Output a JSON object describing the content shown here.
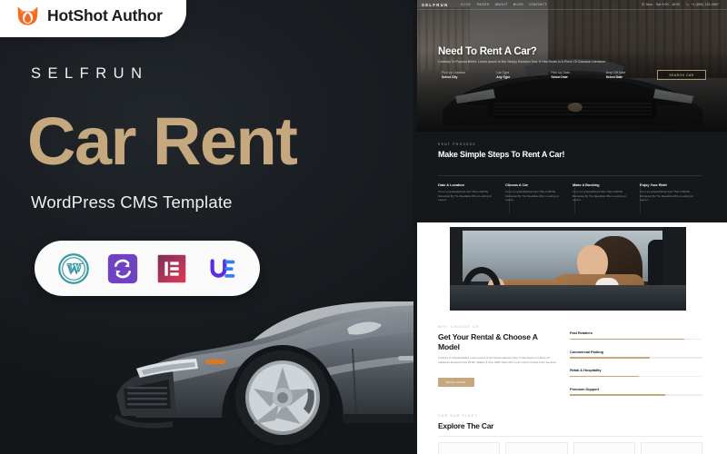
{
  "promo": {
    "author_badge": {
      "label": "HotShot Author",
      "icon": "fox-flame-icon"
    },
    "brand": "SELFRUN",
    "title": "Car Rent",
    "subtitle": "WordPress CMS Template",
    "tech_badges": [
      {
        "name": "wordpress-icon",
        "label": "WordPress",
        "color": "#21759b"
      },
      {
        "name": "revolution-slider-icon",
        "label": "Revolution Slider",
        "color": "#6f42c1"
      },
      {
        "name": "elementor-icon",
        "label": "Elementor",
        "color": "#d9346a"
      },
      {
        "name": "unlimited-elements-icon",
        "label": "Unlimited Elements",
        "color": "#5b2ee6"
      }
    ],
    "background": "#14171a",
    "accent": "#c6a87f"
  },
  "site": {
    "header": {
      "logo": "SELFRUN",
      "nav": [
        {
          "label": "Home",
          "active": true
        },
        {
          "label": "Pages",
          "active": false
        },
        {
          "label": "About",
          "active": false
        },
        {
          "label": "Blog",
          "active": false
        },
        {
          "label": "Contact",
          "active": false
        }
      ],
      "contact": [
        {
          "icon": "clock-icon",
          "text": "Mon - Sat 9:00 - 18:00"
        },
        {
          "icon": "phone-icon",
          "text": "+1 (800) 123-4567"
        }
      ]
    },
    "hero": {
      "title": "Need To Rent A Car?",
      "subtitle": "Contrary To Popular Belief, Lorem Ipsum Is Not Simply Random Text. It Has Roots In A Piece Of Classical Literature.",
      "fields": [
        {
          "label": "Pick Up Location",
          "value": "Select City"
        },
        {
          "label": "Car Type",
          "value": "Any Type"
        },
        {
          "label": "Pick Up Date",
          "value": "Select Date"
        },
        {
          "label": "Drop Off Date",
          "value": "Select Date"
        }
      ],
      "button": "Search Car"
    },
    "steps": {
      "eyebrow": "Rent Process",
      "title": "Make Simple Steps To Rent A Car!",
      "cards": [
        {
          "title": "Date & Location",
          "desc": "It Is A Long Established Fact That A Will Be Distracted By The Readable When Looking At Layout."
        },
        {
          "title": "Choose A Car",
          "desc": "It Is A Long Established Fact That A Will Be Distracted By The Readable When Looking At Layout."
        },
        {
          "title": "Make A Booking",
          "desc": "It Is A Long Established Fact That A Will Be Distracted By The Readable When Looking At Layout."
        },
        {
          "title": "Enjoy Your Ride!",
          "desc": "It Is A Long Established Fact That A Will Be Distracted By The Readable When Looking At Layout."
        }
      ]
    },
    "photo": {
      "alt": "Woman in camel coat driving a car"
    },
    "rental": {
      "eyebrow": "Why Choose Us",
      "title": "Get Your Rental & Choose A Model",
      "paragraph": "Contrary To Popular Belief, Lorem Ipsum Is Not Simply Random Text. It Has Roots In A Piece Of Classical Literature From 45 BC, Making It Over 2000 Years Old. Lorem Ipsum Comes From Sections.",
      "button": "Read More",
      "skills": [
        {
          "label": "Fast Retailers",
          "value": 86
        },
        {
          "label": "Commercial Parking",
          "value": 60
        },
        {
          "label": "Retail & Hospitality",
          "value": 52
        },
        {
          "label": "Premium Support",
          "value": 72
        }
      ]
    },
    "explore": {
      "eyebrow": "Our Car Fleet",
      "title": "Explore The Car",
      "cards": [
        {
          "name": "car-card-1"
        },
        {
          "name": "car-card-2"
        },
        {
          "name": "car-card-3"
        },
        {
          "name": "car-card-4"
        }
      ]
    }
  }
}
